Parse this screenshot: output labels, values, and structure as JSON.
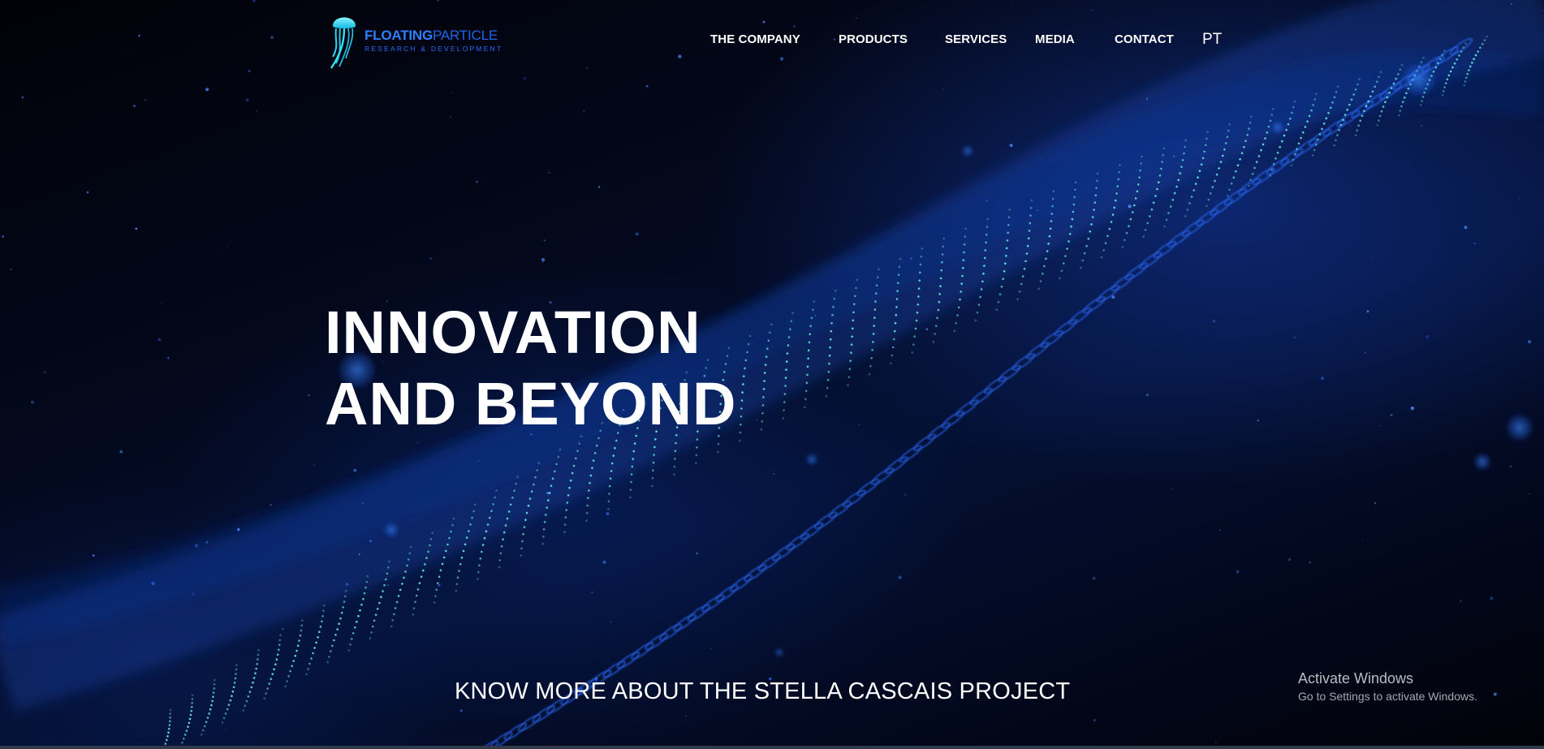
{
  "brand": {
    "name_strong": "FLOATING",
    "name_light": "PARTICLE",
    "tagline": "RESEARCH & DEVELOPMENT",
    "logo_icon": "jellyfish-icon"
  },
  "nav": {
    "items": [
      {
        "label": "THE COMPANY"
      },
      {
        "label": "PRODUCTS"
      },
      {
        "label": "SERVICES"
      },
      {
        "label": "MEDIA"
      },
      {
        "label": "CONTACT"
      }
    ],
    "language": "PT"
  },
  "hero": {
    "title_line1": "INNOVATION",
    "title_line2": "AND BEYOND",
    "cta": "KNOW MORE ABOUT THE STELLA CASCAIS PROJECT"
  },
  "os_overlay": {
    "title": "Activate Windows",
    "subtitle": "Go to Settings to activate Windows."
  },
  "colors": {
    "background": "#02040c",
    "accent_blue": "#2f7fff",
    "particle_teal": "#5fe3d6",
    "particle_blue": "#2a6cff",
    "text": "#ffffff"
  }
}
